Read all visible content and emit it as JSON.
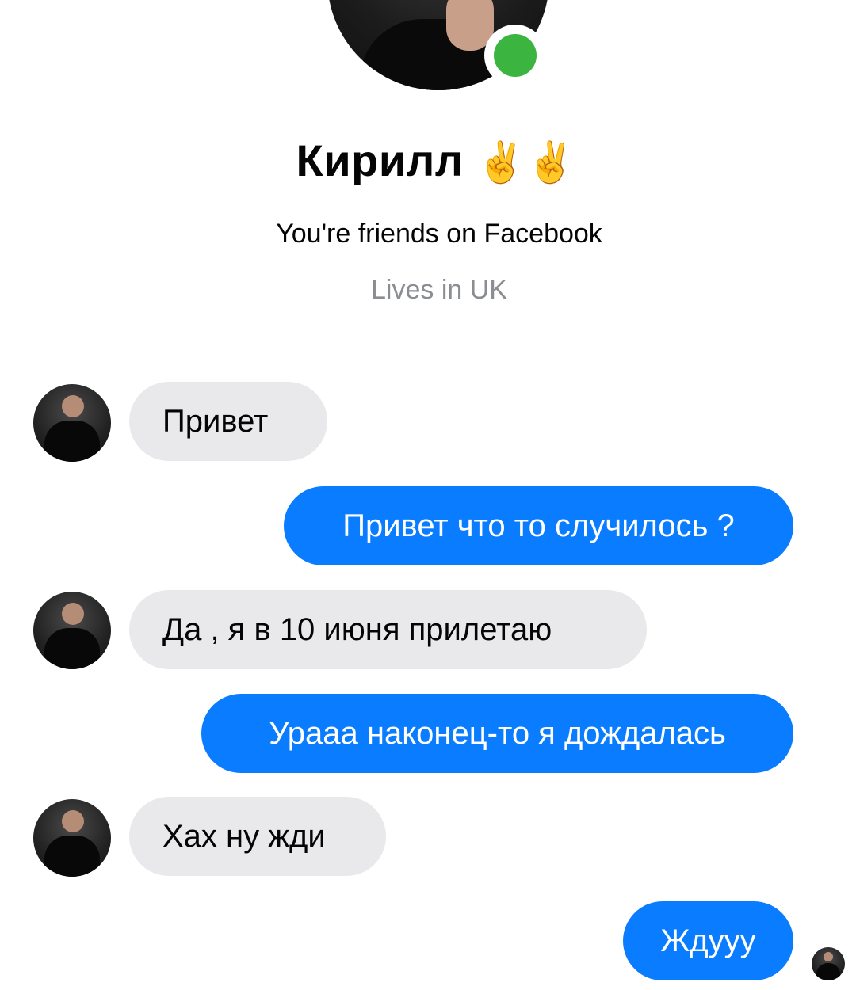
{
  "profile": {
    "name": "Кирилл",
    "name_emoji": "✌️✌️",
    "friends_text": "You're friends on Facebook",
    "location_text": "Lives in UK"
  },
  "colors": {
    "outgoing_bubble": "#0a7cff",
    "incoming_bubble": "#e9e9eb",
    "online_indicator": "#3cb540",
    "secondary_text": "#8a8d91"
  },
  "messages": [
    {
      "direction": "incoming",
      "text": "Привет"
    },
    {
      "direction": "outgoing",
      "text": "Привет что то случилось ?"
    },
    {
      "direction": "incoming",
      "text": "Да , я в 10 июня прилетаю"
    },
    {
      "direction": "outgoing",
      "text": "Урааа наконец-то я дождалась"
    },
    {
      "direction": "incoming",
      "text": "Хах ну жди"
    },
    {
      "direction": "outgoing",
      "text": "Ждууу"
    }
  ]
}
